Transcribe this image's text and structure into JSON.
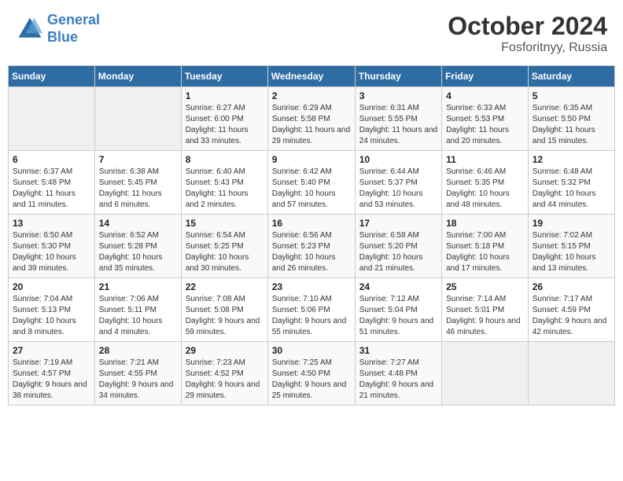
{
  "header": {
    "logo_line1": "General",
    "logo_line2": "Blue",
    "month": "October 2024",
    "location": "Fosforitnyy, Russia"
  },
  "weekdays": [
    "Sunday",
    "Monday",
    "Tuesday",
    "Wednesday",
    "Thursday",
    "Friday",
    "Saturday"
  ],
  "weeks": [
    [
      {
        "day": "",
        "sunrise": "",
        "sunset": "",
        "daylight": ""
      },
      {
        "day": "",
        "sunrise": "",
        "sunset": "",
        "daylight": ""
      },
      {
        "day": "1",
        "sunrise": "Sunrise: 6:27 AM",
        "sunset": "Sunset: 6:00 PM",
        "daylight": "Daylight: 11 hours and 33 minutes."
      },
      {
        "day": "2",
        "sunrise": "Sunrise: 6:29 AM",
        "sunset": "Sunset: 5:58 PM",
        "daylight": "Daylight: 11 hours and 29 minutes."
      },
      {
        "day": "3",
        "sunrise": "Sunrise: 6:31 AM",
        "sunset": "Sunset: 5:55 PM",
        "daylight": "Daylight: 11 hours and 24 minutes."
      },
      {
        "day": "4",
        "sunrise": "Sunrise: 6:33 AM",
        "sunset": "Sunset: 5:53 PM",
        "daylight": "Daylight: 11 hours and 20 minutes."
      },
      {
        "day": "5",
        "sunrise": "Sunrise: 6:35 AM",
        "sunset": "Sunset: 5:50 PM",
        "daylight": "Daylight: 11 hours and 15 minutes."
      }
    ],
    [
      {
        "day": "6",
        "sunrise": "Sunrise: 6:37 AM",
        "sunset": "Sunset: 5:48 PM",
        "daylight": "Daylight: 11 hours and 11 minutes."
      },
      {
        "day": "7",
        "sunrise": "Sunrise: 6:38 AM",
        "sunset": "Sunset: 5:45 PM",
        "daylight": "Daylight: 11 hours and 6 minutes."
      },
      {
        "day": "8",
        "sunrise": "Sunrise: 6:40 AM",
        "sunset": "Sunset: 5:43 PM",
        "daylight": "Daylight: 11 hours and 2 minutes."
      },
      {
        "day": "9",
        "sunrise": "Sunrise: 6:42 AM",
        "sunset": "Sunset: 5:40 PM",
        "daylight": "Daylight: 10 hours and 57 minutes."
      },
      {
        "day": "10",
        "sunrise": "Sunrise: 6:44 AM",
        "sunset": "Sunset: 5:37 PM",
        "daylight": "Daylight: 10 hours and 53 minutes."
      },
      {
        "day": "11",
        "sunrise": "Sunrise: 6:46 AM",
        "sunset": "Sunset: 5:35 PM",
        "daylight": "Daylight: 10 hours and 48 minutes."
      },
      {
        "day": "12",
        "sunrise": "Sunrise: 6:48 AM",
        "sunset": "Sunset: 5:32 PM",
        "daylight": "Daylight: 10 hours and 44 minutes."
      }
    ],
    [
      {
        "day": "13",
        "sunrise": "Sunrise: 6:50 AM",
        "sunset": "Sunset: 5:30 PM",
        "daylight": "Daylight: 10 hours and 39 minutes."
      },
      {
        "day": "14",
        "sunrise": "Sunrise: 6:52 AM",
        "sunset": "Sunset: 5:28 PM",
        "daylight": "Daylight: 10 hours and 35 minutes."
      },
      {
        "day": "15",
        "sunrise": "Sunrise: 6:54 AM",
        "sunset": "Sunset: 5:25 PM",
        "daylight": "Daylight: 10 hours and 30 minutes."
      },
      {
        "day": "16",
        "sunrise": "Sunrise: 6:56 AM",
        "sunset": "Sunset: 5:23 PM",
        "daylight": "Daylight: 10 hours and 26 minutes."
      },
      {
        "day": "17",
        "sunrise": "Sunrise: 6:58 AM",
        "sunset": "Sunset: 5:20 PM",
        "daylight": "Daylight: 10 hours and 21 minutes."
      },
      {
        "day": "18",
        "sunrise": "Sunrise: 7:00 AM",
        "sunset": "Sunset: 5:18 PM",
        "daylight": "Daylight: 10 hours and 17 minutes."
      },
      {
        "day": "19",
        "sunrise": "Sunrise: 7:02 AM",
        "sunset": "Sunset: 5:15 PM",
        "daylight": "Daylight: 10 hours and 13 minutes."
      }
    ],
    [
      {
        "day": "20",
        "sunrise": "Sunrise: 7:04 AM",
        "sunset": "Sunset: 5:13 PM",
        "daylight": "Daylight: 10 hours and 8 minutes."
      },
      {
        "day": "21",
        "sunrise": "Sunrise: 7:06 AM",
        "sunset": "Sunset: 5:11 PM",
        "daylight": "Daylight: 10 hours and 4 minutes."
      },
      {
        "day": "22",
        "sunrise": "Sunrise: 7:08 AM",
        "sunset": "Sunset: 5:08 PM",
        "daylight": "Daylight: 9 hours and 59 minutes."
      },
      {
        "day": "23",
        "sunrise": "Sunrise: 7:10 AM",
        "sunset": "Sunset: 5:06 PM",
        "daylight": "Daylight: 9 hours and 55 minutes."
      },
      {
        "day": "24",
        "sunrise": "Sunrise: 7:12 AM",
        "sunset": "Sunset: 5:04 PM",
        "daylight": "Daylight: 9 hours and 51 minutes."
      },
      {
        "day": "25",
        "sunrise": "Sunrise: 7:14 AM",
        "sunset": "Sunset: 5:01 PM",
        "daylight": "Daylight: 9 hours and 46 minutes."
      },
      {
        "day": "26",
        "sunrise": "Sunrise: 7:17 AM",
        "sunset": "Sunset: 4:59 PM",
        "daylight": "Daylight: 9 hours and 42 minutes."
      }
    ],
    [
      {
        "day": "27",
        "sunrise": "Sunrise: 7:19 AM",
        "sunset": "Sunset: 4:57 PM",
        "daylight": "Daylight: 9 hours and 38 minutes."
      },
      {
        "day": "28",
        "sunrise": "Sunrise: 7:21 AM",
        "sunset": "Sunset: 4:55 PM",
        "daylight": "Daylight: 9 hours and 34 minutes."
      },
      {
        "day": "29",
        "sunrise": "Sunrise: 7:23 AM",
        "sunset": "Sunset: 4:52 PM",
        "daylight": "Daylight: 9 hours and 29 minutes."
      },
      {
        "day": "30",
        "sunrise": "Sunrise: 7:25 AM",
        "sunset": "Sunset: 4:50 PM",
        "daylight": "Daylight: 9 hours and 25 minutes."
      },
      {
        "day": "31",
        "sunrise": "Sunrise: 7:27 AM",
        "sunset": "Sunset: 4:48 PM",
        "daylight": "Daylight: 9 hours and 21 minutes."
      },
      {
        "day": "",
        "sunrise": "",
        "sunset": "",
        "daylight": ""
      },
      {
        "day": "",
        "sunrise": "",
        "sunset": "",
        "daylight": ""
      }
    ]
  ]
}
